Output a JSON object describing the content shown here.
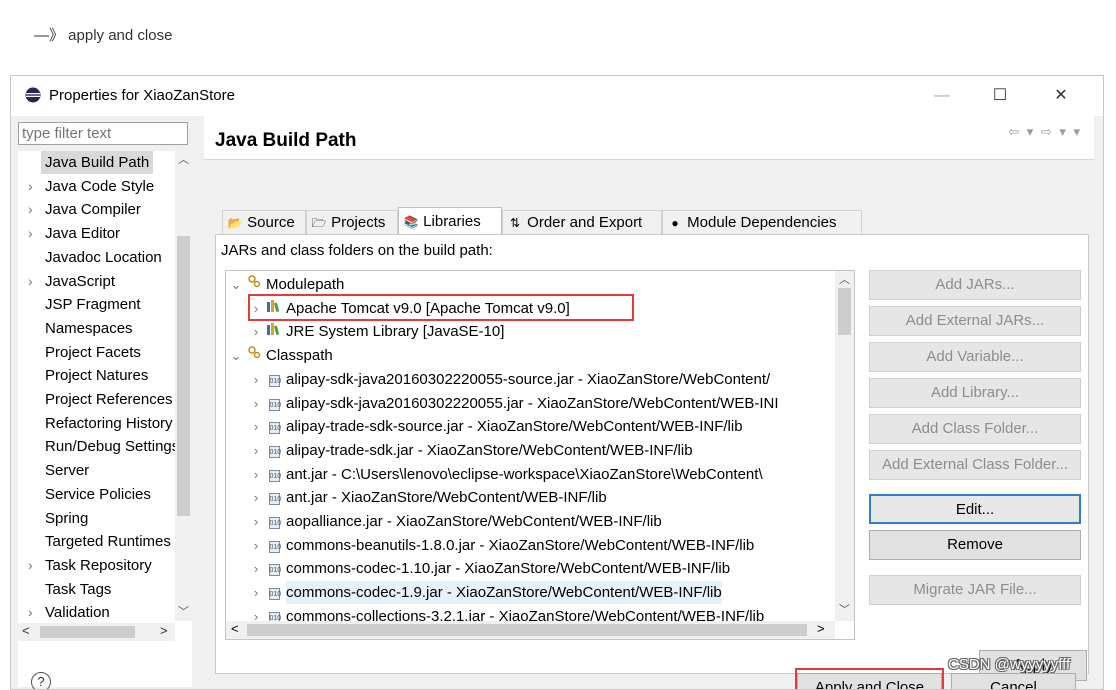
{
  "caption": "—》 apply and close",
  "window": {
    "title": "Properties for XiaoZanStore",
    "minimize": "—",
    "maximize": "☐",
    "close": "✕"
  },
  "filter": {
    "placeholder": "type filter text"
  },
  "sidebar": {
    "items": [
      {
        "label": "Java Build Path",
        "chevron": "",
        "selected": true
      },
      {
        "label": "Java Code Style",
        "chevron": "›"
      },
      {
        "label": "Java Compiler",
        "chevron": "›"
      },
      {
        "label": "Java Editor",
        "chevron": "›"
      },
      {
        "label": "Javadoc Location",
        "chevron": ""
      },
      {
        "label": "JavaScript",
        "chevron": "›"
      },
      {
        "label": "JSP Fragment",
        "chevron": ""
      },
      {
        "label": "Namespaces",
        "chevron": ""
      },
      {
        "label": "Project Facets",
        "chevron": ""
      },
      {
        "label": "Project Natures",
        "chevron": ""
      },
      {
        "label": "Project References",
        "chevron": ""
      },
      {
        "label": "Refactoring History",
        "chevron": ""
      },
      {
        "label": "Run/Debug Settings",
        "chevron": ""
      },
      {
        "label": "Server",
        "chevron": ""
      },
      {
        "label": "Service Policies",
        "chevron": ""
      },
      {
        "label": "Spring",
        "chevron": ""
      },
      {
        "label": "Targeted Runtimes",
        "chevron": ""
      },
      {
        "label": "Task Repository",
        "chevron": "›"
      },
      {
        "label": "Task Tags",
        "chevron": ""
      },
      {
        "label": "Validation",
        "chevron": "›"
      }
    ]
  },
  "page": {
    "title": "Java Build Path",
    "nav": "⇦ ▾ ⇨ ▾ ▾"
  },
  "tabs": [
    {
      "label": "Source",
      "icon": "📂"
    },
    {
      "label": "Projects",
      "icon": "🗁"
    },
    {
      "label": "Libraries",
      "icon": "📚",
      "active": true
    },
    {
      "label": "Order and Export",
      "icon": "⇅"
    },
    {
      "label": "Module Dependencies",
      "icon": "●"
    }
  ],
  "libraries": {
    "heading": "JARs and class folders on the build path:",
    "rows": [
      {
        "label": "Modulepath",
        "chevron": "⌄",
        "level": 0,
        "icon": "group"
      },
      {
        "label": "Apache Tomcat v9.0 [Apache Tomcat v9.0]",
        "chevron": "›",
        "level": 1,
        "icon": "lib"
      },
      {
        "label": "JRE System Library [JavaSE-10]",
        "chevron": "›",
        "level": 1,
        "icon": "lib"
      },
      {
        "label": "Classpath",
        "chevron": "⌄",
        "level": 0,
        "icon": "group"
      },
      {
        "label": "alipay-sdk-java20160302220055-source.jar - XiaoZanStore/WebContent/",
        "chevron": "›",
        "level": 1,
        "icon": "jar"
      },
      {
        "label": "alipay-sdk-java20160302220055.jar - XiaoZanStore/WebContent/WEB-INI",
        "chevron": "›",
        "level": 1,
        "icon": "jar"
      },
      {
        "label": "alipay-trade-sdk-source.jar - XiaoZanStore/WebContent/WEB-INF/lib",
        "chevron": "›",
        "level": 1,
        "icon": "jar"
      },
      {
        "label": "alipay-trade-sdk.jar - XiaoZanStore/WebContent/WEB-INF/lib",
        "chevron": "›",
        "level": 1,
        "icon": "jar"
      },
      {
        "label": "ant.jar - C:\\Users\\lenovo\\eclipse-workspace\\XiaoZanStore\\WebContent\\",
        "chevron": "›",
        "level": 1,
        "icon": "jar"
      },
      {
        "label": "ant.jar - XiaoZanStore/WebContent/WEB-INF/lib",
        "chevron": "›",
        "level": 1,
        "icon": "jar"
      },
      {
        "label": "aopalliance.jar - XiaoZanStore/WebContent/WEB-INF/lib",
        "chevron": "›",
        "level": 1,
        "icon": "jar"
      },
      {
        "label": "commons-beanutils-1.8.0.jar - XiaoZanStore/WebContent/WEB-INF/lib",
        "chevron": "›",
        "level": 1,
        "icon": "jar"
      },
      {
        "label": "commons-codec-1.10.jar - XiaoZanStore/WebContent/WEB-INF/lib",
        "chevron": "›",
        "level": 1,
        "icon": "jar"
      },
      {
        "label": "commons-codec-1.9.jar - XiaoZanStore/WebContent/WEB-INF/lib",
        "chevron": "›",
        "level": 1,
        "icon": "jar",
        "selected": true
      },
      {
        "label": "commons-collections-3.2.1.jar - XiaoZanStore/WebContent/WEB-INF/lib",
        "chevron": "›",
        "level": 1,
        "icon": "jar"
      }
    ]
  },
  "buttons": {
    "add_jars": "Add JARs...",
    "add_external_jars": "Add External JARs...",
    "add_variable": "Add Variable...",
    "add_library": "Add Library...",
    "add_class_folder": "Add Class Folder...",
    "add_external_class_folder": "Add External Class Folder...",
    "edit": "Edit...",
    "remove": "Remove",
    "migrate_jar": "Migrate JAR File...",
    "apply": "Apply",
    "apply_and_close": "Apply and Close",
    "cancel": "Cancel",
    "help": "?"
  },
  "colors": {
    "highlight_box": "#e03c3c",
    "focus": "#2f7cd0",
    "selection": "#e5f1fb"
  },
  "watermark": "CSDN @wyyyyyfff"
}
